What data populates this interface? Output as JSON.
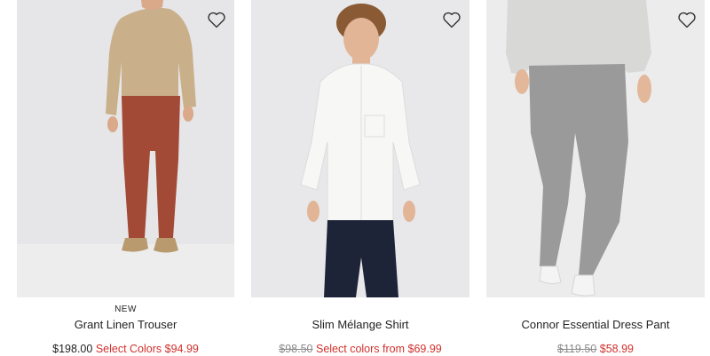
{
  "products": [
    {
      "badge": "NEW",
      "name": "Grant Linen Trouser",
      "price": "$198.00",
      "sale_text": "Select Colors $94.99"
    },
    {
      "badge": "",
      "name": "Slim Mélange Shirt",
      "price_original": "$98.50",
      "sale_text": "Select colors from $69.99"
    },
    {
      "badge": "",
      "name": "Connor Essential Dress Pant",
      "price_original": "$119.50",
      "sale_text": "$58.99"
    }
  ],
  "icons": {
    "favorite": "heart-outline-icon"
  },
  "colors": {
    "sale": "#d0312d",
    "original": "#8a8a8a",
    "text": "#222222"
  }
}
